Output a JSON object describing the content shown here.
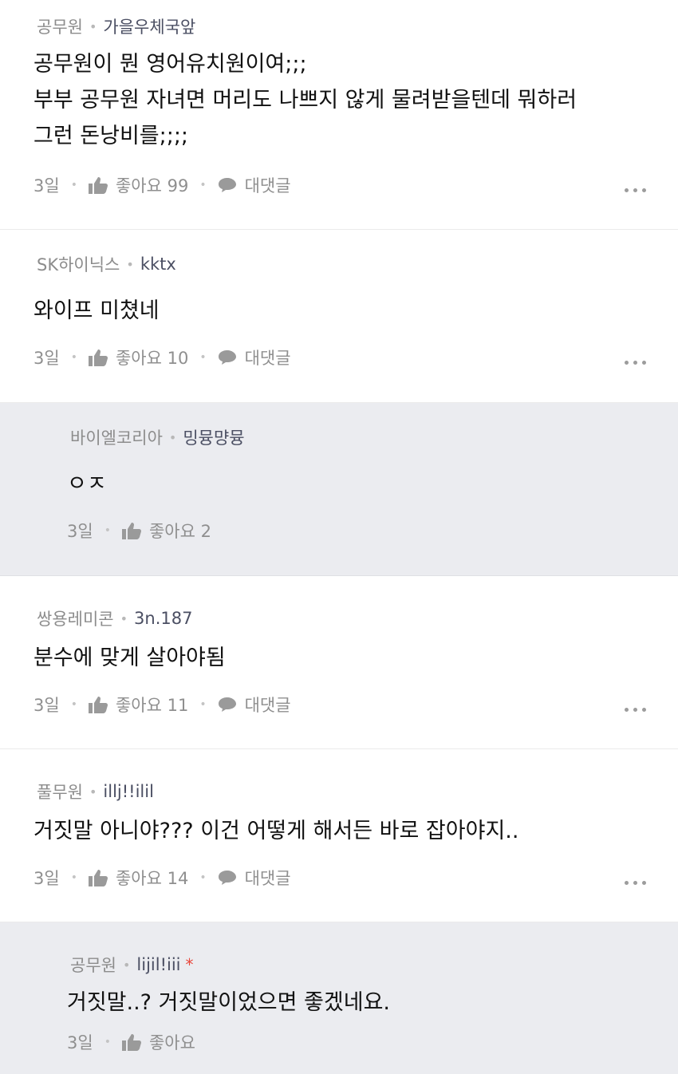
{
  "comments": [
    {
      "company": "공무원",
      "nick": "가을우체국앞",
      "body": "공무원이 뭔 영어유치원이여;;;\n부부 공무원 자녀면 머리도 나쁘지 않게 물려받을텐데 뭐하러\n그런 돈낭비를;;;;",
      "time": "3일",
      "like_label": "좋아요 99",
      "reply_label": "대댓글"
    },
    {
      "company": "SK하이닉스",
      "nick": "kktx",
      "body": "와이프 미쳤네",
      "time": "3일",
      "like_label": "좋아요 10",
      "reply_label": "대댓글"
    },
    {
      "company": "바이엘코리아",
      "nick": "밍뮹먕뮹",
      "body": "ㅇㅈ",
      "time": "3일",
      "like_label": "좋아요 2"
    },
    {
      "company": "쌍용레미콘",
      "nick": "3n.187",
      "body": "분수에 맞게 살아야됨",
      "time": "3일",
      "like_label": "좋아요 11",
      "reply_label": "대댓글"
    },
    {
      "company": "풀무원",
      "nick": "illj!!ilil",
      "body": "거짓말 아니야??? 이건 어떻게 해서든 바로 잡아야지..",
      "time": "3일",
      "like_label": "좋아요 14",
      "reply_label": "대댓글"
    },
    {
      "company": "공무원",
      "nick": "lijil!iii",
      "badge": "*",
      "body": "거짓말..? 거짓말이었으면 좋겠네요.",
      "time": "3일",
      "like_label": "좋아요"
    }
  ],
  "icons": {
    "like": "thumbs-up-icon",
    "reply": "speech-bubble-icon",
    "more": "more-dots-icon"
  },
  "colors": {
    "reply_bg": "#ebecf0",
    "nick": "#4b4f63",
    "meta": "#8f8f8f",
    "badge": "#e8473b"
  }
}
